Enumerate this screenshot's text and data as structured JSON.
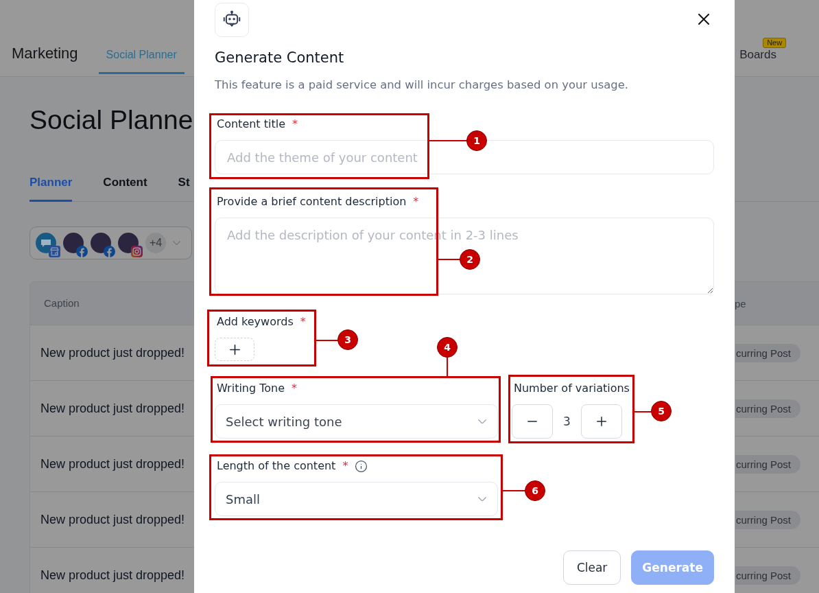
{
  "header": {
    "title": "Marketing",
    "nav": [
      {
        "label": "Social Planner",
        "selected": true
      },
      {
        "label": "Boards",
        "selected": false,
        "tag": "New"
      }
    ]
  },
  "page": {
    "title": "Social Planne",
    "tabs": [
      {
        "label": "Planner",
        "selected": true
      },
      {
        "label": "Content",
        "selected": false
      },
      {
        "label": "St",
        "selected": false
      }
    ],
    "accounts": {
      "avatars": [
        {
          "kind": "logo",
          "badge": {
            "kind": "store"
          }
        },
        {
          "kind": "photo",
          "badge": {
            "kind": "facebook"
          }
        },
        {
          "kind": "photo",
          "badge": {
            "kind": "facebook"
          }
        },
        {
          "kind": "photo",
          "badge": {
            "kind": "instagram"
          }
        }
      ],
      "more": "+4"
    }
  },
  "table": {
    "columns": [
      "Caption",
      "pe"
    ],
    "rows": [
      [
        "New product just dropped!",
        "curring Post"
      ],
      [
        "New product just dropped!",
        "curring Post"
      ],
      [
        "New product just dropped!",
        "curring Post"
      ],
      [
        "New product just dropped!",
        "curring Post"
      ],
      [
        "New product just dropped!",
        "curring Post"
      ]
    ]
  },
  "dialog": {
    "title": "Generate Content",
    "subtitle": "This feature is a paid service and will incur charges based on your usage.",
    "rows": [
      {
        "fields": [
          {
            "kind": "text",
            "label": "Content title",
            "required_mark": "*",
            "placeholder": "Add the theme of your content"
          }
        ]
      },
      {
        "fields": [
          {
            "kind": "textarea",
            "label": "Provide a brief content description",
            "required_mark": "*",
            "placeholder": "Add the description of your content in 2-3 lines"
          }
        ]
      },
      {
        "fields": [
          {
            "kind": "keywords",
            "label": "Add keywords",
            "required_mark": "*"
          }
        ]
      },
      {
        "fields": [
          {
            "kind": "select",
            "label": "Writing Tone",
            "required_mark": "*",
            "placeholder": "Select writing tone"
          },
          {
            "kind": "stepper",
            "label": "Number of variations",
            "value": "3"
          }
        ]
      },
      {
        "fields": [
          {
            "kind": "select",
            "label": "Length of the content",
            "required_mark": "*",
            "info": true,
            "value": "Small"
          }
        ]
      }
    ],
    "buttons": [
      {
        "label": "Clear",
        "kind": "secondary",
        "disabled": false
      },
      {
        "label": "Generate",
        "kind": "primary",
        "disabled": true
      }
    ]
  },
  "annotations": [
    {
      "number": "1"
    },
    {
      "number": "2"
    },
    {
      "number": "3"
    },
    {
      "number": "4"
    },
    {
      "number": "5"
    },
    {
      "number": "6"
    }
  ]
}
